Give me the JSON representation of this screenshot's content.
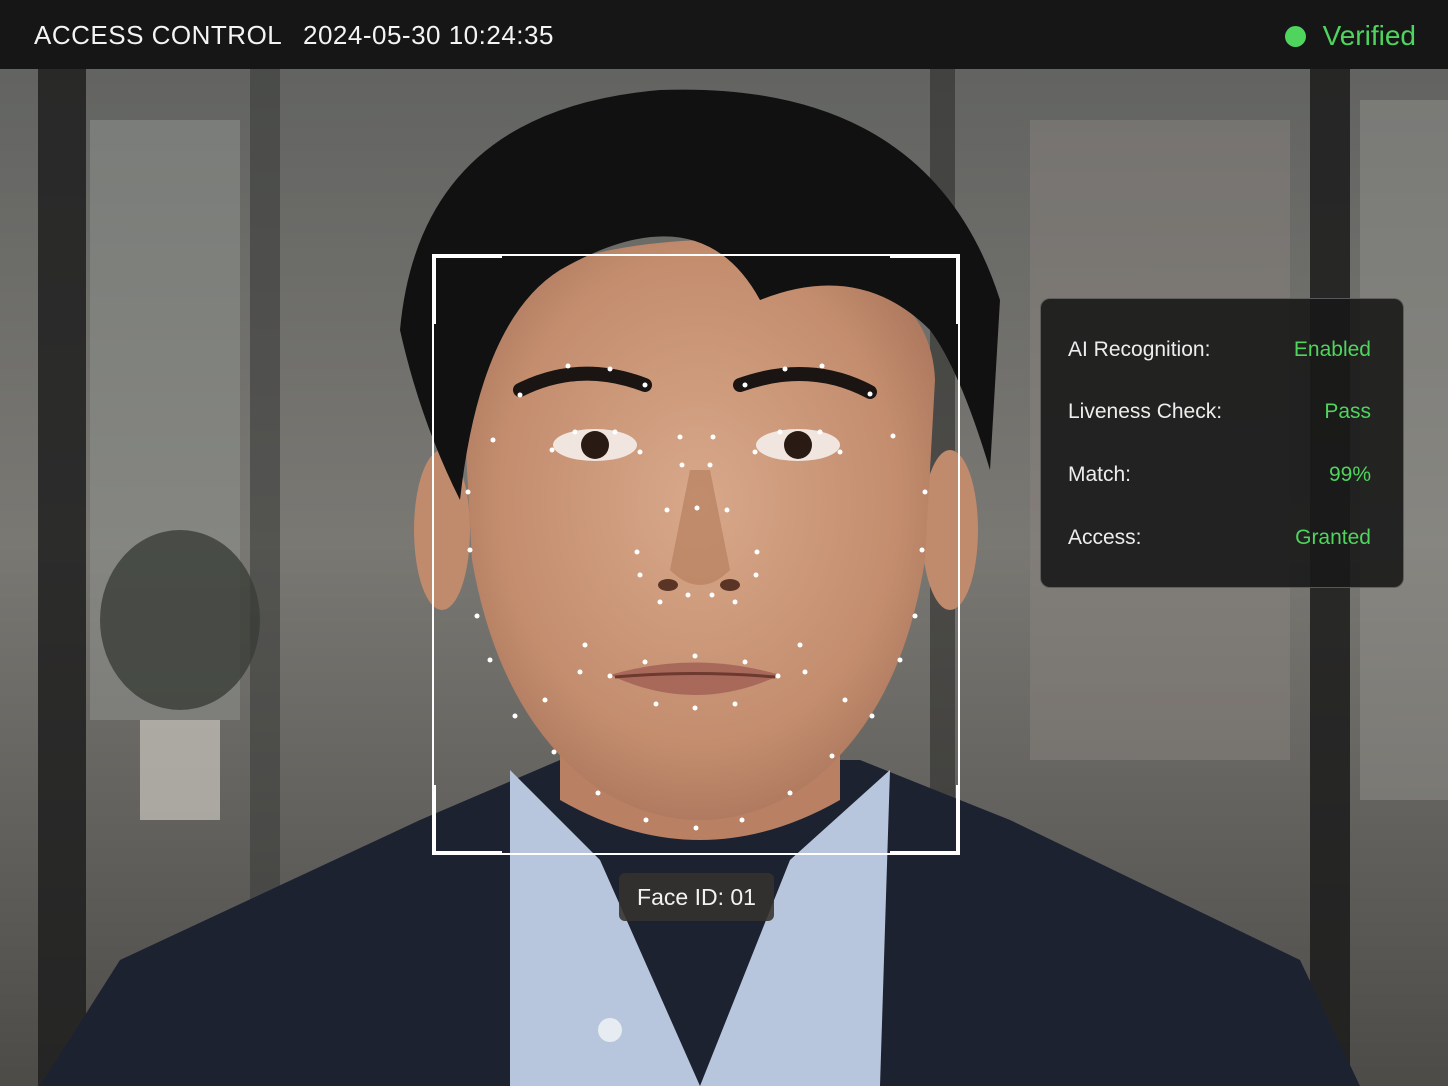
{
  "header": {
    "title": "ACCESS CONTROL",
    "timestamp": "2024-05-30 10:24:35",
    "status_label": "Verified",
    "status_color": "#4fd45d"
  },
  "detection": {
    "face_id_label": "Face ID: 01"
  },
  "info_panel": {
    "rows": [
      {
        "label": "AI Recognition:",
        "value": "Enabled"
      },
      {
        "label": "Liveness Check:",
        "value": "Pass"
      },
      {
        "label": "Match:",
        "value": "99%"
      },
      {
        "label": "Access:",
        "value": "Granted"
      }
    ]
  },
  "colors": {
    "accent": "#4fd45d",
    "bar_bg": "#161616"
  }
}
